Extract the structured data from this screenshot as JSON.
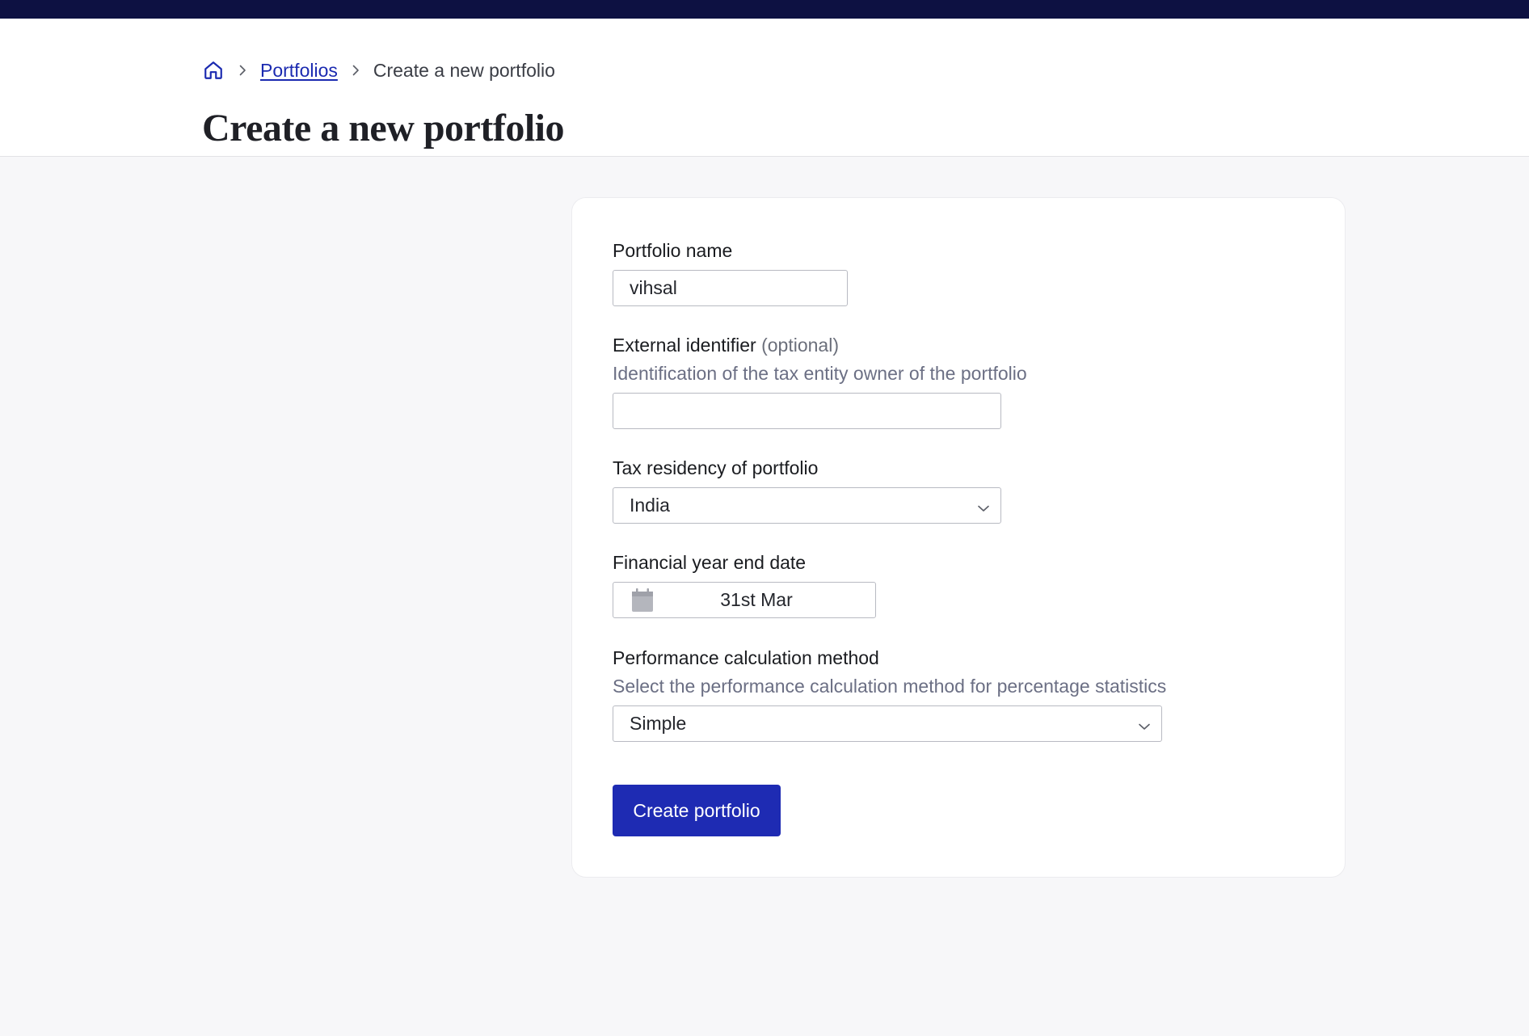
{
  "breadcrumb": {
    "home_icon": "home-icon",
    "portfolios_label": "Portfolios",
    "current_label": "Create a new portfolio"
  },
  "header": {
    "title": "Create a new portfolio"
  },
  "form": {
    "portfolio_name": {
      "label": "Portfolio name",
      "value": "vihsal"
    },
    "external_identifier": {
      "label": "External identifier",
      "optional_label": "(optional)",
      "hint": "Identification of the tax entity owner of the portfolio",
      "value": ""
    },
    "tax_residency": {
      "label": "Tax residency of portfolio",
      "selected": "India"
    },
    "financial_year_end": {
      "label": "Financial year end date",
      "value": "31st Mar",
      "icon": "calendar-icon"
    },
    "performance_method": {
      "label": "Performance calculation method",
      "hint": "Select the performance calculation method for percentage statistics",
      "selected": "Simple"
    },
    "submit_label": "Create portfolio"
  },
  "colors": {
    "topbar": "#0d1142",
    "primary_button": "#1e2bb3",
    "link": "#1b2ab0",
    "page_background": "#f7f7f9"
  }
}
